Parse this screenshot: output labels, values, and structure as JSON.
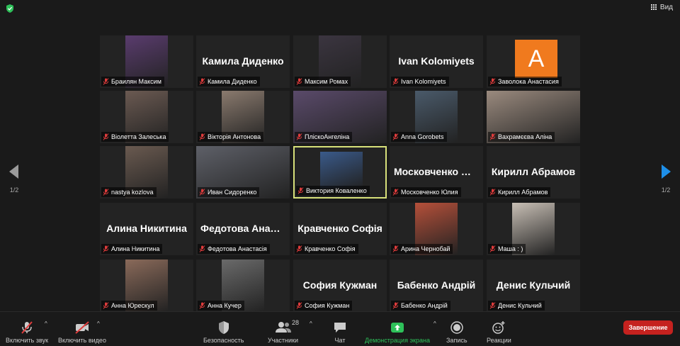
{
  "header": {
    "view_label": "Вид"
  },
  "nav": {
    "page_left": "1/2",
    "page_right": "1/2"
  },
  "tiles": [
    {
      "label": "Браилян Максим",
      "name_text": "",
      "kind": "video",
      "bg": "#5a3c6e"
    },
    {
      "label": "Камила Диденко",
      "name_text": "Камила Диденко",
      "kind": "name"
    },
    {
      "label": "Максим Ромах",
      "name_text": "",
      "kind": "video",
      "bg": "#3b3540"
    },
    {
      "label": "Ivan Kolomiyets",
      "name_text": "Ivan Kolomiyets",
      "kind": "name"
    },
    {
      "label": "Заволока Анастасия",
      "name_text": "",
      "kind": "avatar",
      "avatar_letter": "A"
    },
    {
      "label": "Віолетта Залеська",
      "name_text": "",
      "kind": "video",
      "bg": "#6b5a52"
    },
    {
      "label": "Вікторія Антонова",
      "name_text": "",
      "kind": "video",
      "bg": "#8a7a6e"
    },
    {
      "label": "ПліскоАнгеліна",
      "name_text": "",
      "kind": "video",
      "bg": "#5a4a6a"
    },
    {
      "label": "Anna Gorobets",
      "name_text": "",
      "kind": "video",
      "bg": "#4a5a6a"
    },
    {
      "label": "Вахрамєєва Аліна",
      "name_text": "",
      "kind": "video",
      "bg": "#9a8a7e"
    },
    {
      "label": "nastya kozlova",
      "name_text": "",
      "kind": "video",
      "bg": "#6a5a50"
    },
    {
      "label": "Иван Сидоренко",
      "name_text": "",
      "kind": "video",
      "bg": "#5e6068"
    },
    {
      "label": "Виктория Коваленко",
      "name_text": "",
      "kind": "video",
      "bg": "#3a5a8a",
      "active": true
    },
    {
      "label": "Московченко Юлия",
      "name_text": "Московченко Юлия",
      "kind": "name"
    },
    {
      "label": "Кирилл Абрамов",
      "name_text": "Кирилл Абрамов",
      "kind": "name"
    },
    {
      "label": "Алина Никитина",
      "name_text": "Алина Никитина",
      "kind": "name"
    },
    {
      "label": "Федотова Анастасія",
      "name_text": "Федотова Анастасія",
      "kind": "name"
    },
    {
      "label": "Кравченко Софія",
      "name_text": "Кравченко Софія",
      "kind": "name"
    },
    {
      "label": "Арина Чернобай",
      "name_text": "",
      "kind": "video",
      "bg": "#b5503a"
    },
    {
      "label": "Маша : )",
      "name_text": "",
      "kind": "video",
      "bg": "#c8bfb5"
    },
    {
      "label": "Анна Юрескул",
      "name_text": "",
      "kind": "video",
      "bg": "#8a6a5a"
    },
    {
      "label": "Анна Кучер",
      "name_text": "",
      "kind": "video",
      "bg": "#6a6a6a"
    },
    {
      "label": "София Кужман",
      "name_text": "София Кужман",
      "kind": "name"
    },
    {
      "label": "Бабенко Андрій",
      "name_text": "Бабенко Андрій",
      "kind": "name"
    },
    {
      "label": "Денис Кульчий",
      "name_text": "Денис Кульчий",
      "kind": "name"
    }
  ],
  "toolbar": {
    "audio": "Включить звук",
    "video": "Включить видео",
    "security": "Безопасность",
    "participants": "Участники",
    "participants_count": "28",
    "chat": "Чат",
    "share": "Демонстрация экрана",
    "record": "Запись",
    "reactions": "Реакции",
    "end": "Завершение"
  },
  "colors": {
    "share_green": "#2ec15a",
    "end_red": "#c5221f",
    "active_border": "#d7e07a",
    "nav_arrow_right": "#1e8fe8"
  }
}
